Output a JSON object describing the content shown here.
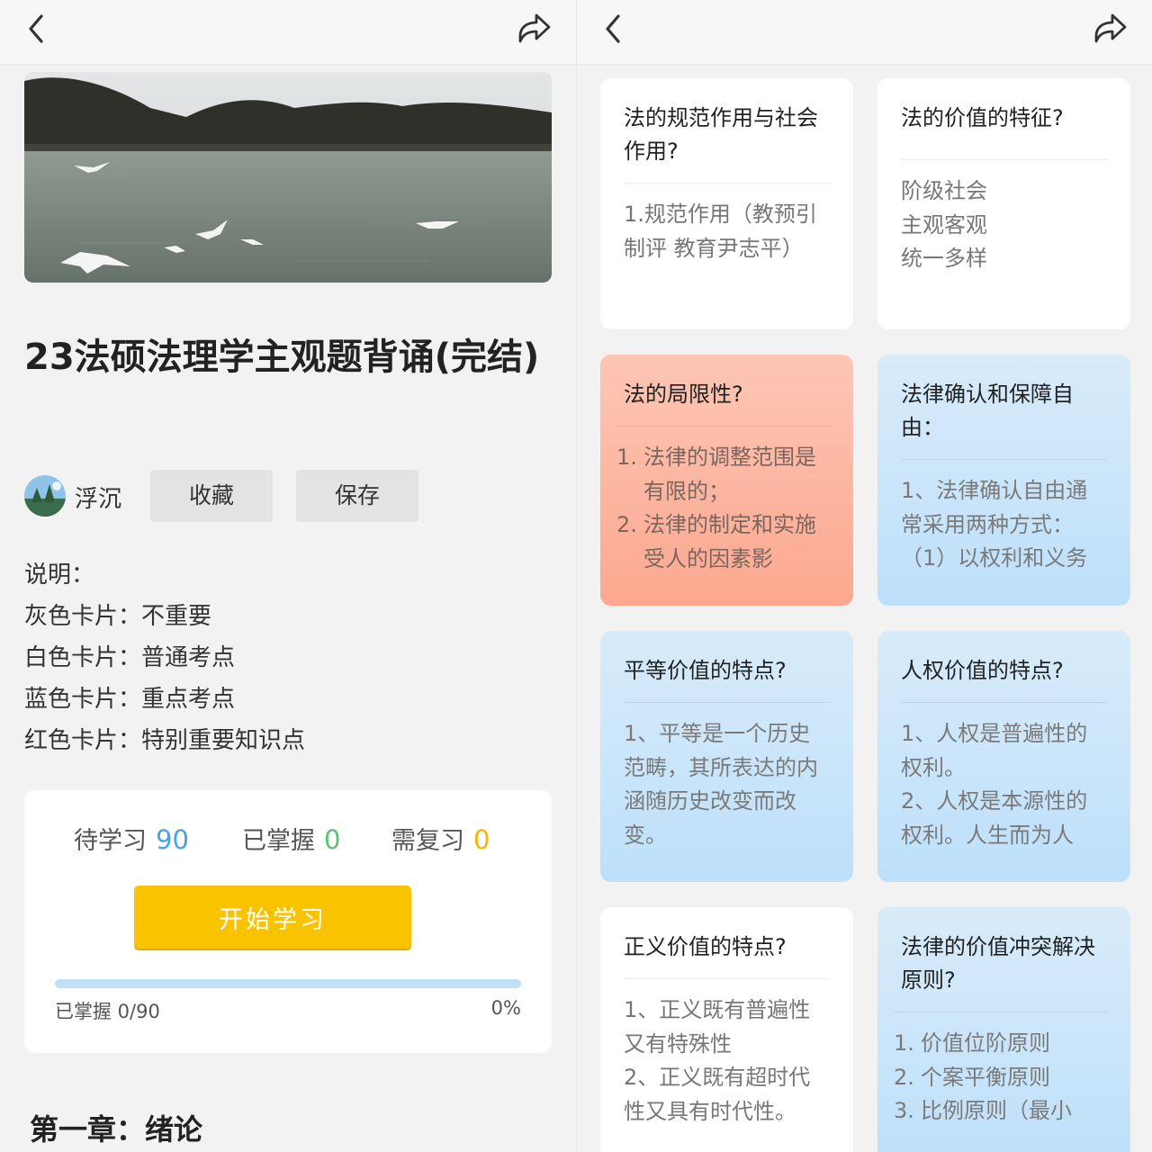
{
  "left": {
    "title": "23法硕法理学主观题背诵(完结)",
    "author": "浮沉",
    "buttons": {
      "collect": "收藏",
      "save": "保存"
    },
    "description": [
      "说明：",
      "灰色卡片：不重要",
      "白色卡片：普通考点",
      "蓝色卡片：重点考点",
      "红色卡片：特别重要知识点"
    ],
    "stats": {
      "pending_label": "待学习",
      "pending_value": "90",
      "mastered_label": "已掌握",
      "mastered_value": "0",
      "review_label": "需复习",
      "review_value": "0"
    },
    "start_button": "开始学习",
    "progress": {
      "label": "已掌握 0/90",
      "percent_text": "0%",
      "fraction": 0
    },
    "chapter": "第一章：绪论"
  },
  "right": {
    "cards": [
      {
        "color": "white",
        "question": "法的规范作用与社会作用?",
        "answer": "1.规范作用（教预引制评 教育尹志平）"
      },
      {
        "color": "white",
        "question": "法的价值的特征?",
        "answer": "阶级社会\n主观客观\n统一多样"
      },
      {
        "color": "red",
        "question": "法的局限性?",
        "list": [
          "法律的调整范围是有限的；",
          "法律的制定和实施受人的因素影"
        ]
      },
      {
        "color": "blue",
        "question": "法律确认和保障自由：",
        "answer": "1、法律确认自由通常采用两种方式：（1）以权利和义务"
      },
      {
        "color": "blue",
        "question": "平等价值的特点?",
        "answer": "1、平等是一个历史范畴，其所表达的内涵随历史改变而改变。"
      },
      {
        "color": "blue",
        "question": "人权价值的特点?",
        "answer": "1、人权是普遍性的权利。\n2、人权是本源性的权利。人生而为人"
      },
      {
        "color": "white",
        "question": "正义价值的特点?",
        "answer": "1、正义既有普遍性又有特殊性\n2、正义既有超时代性又具有时代性。"
      },
      {
        "color": "blue",
        "question": "法律的价值冲突解决原则?",
        "list": [
          "价值位阶原则",
          "个案平衡原则",
          "比例原则（最小"
        ]
      }
    ]
  },
  "colors": {
    "accent_yellow": "#f9c300",
    "stat_blue": "#4aa3e0",
    "stat_green": "#5dc16d",
    "stat_orange": "#f5b800"
  },
  "icons": [
    "back-arrow-icon",
    "share-icon"
  ]
}
